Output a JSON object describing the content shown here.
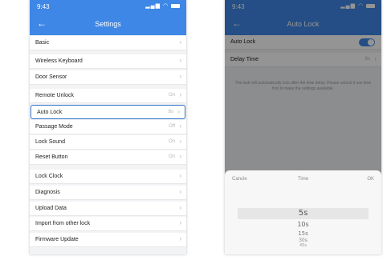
{
  "colors": {
    "accent": "#3e87e6",
    "highlight_border": "#3473c8"
  },
  "left_screen": {
    "status_time": "9:43",
    "title": "Settings",
    "rows": [
      {
        "label": "Basic",
        "value": ""
      },
      {
        "label": "Wireless Keyboard",
        "value": ""
      },
      {
        "label": "Door Sensor",
        "value": ""
      },
      {
        "label": "Remote Unlock",
        "value": "On"
      },
      {
        "label": "Auto Lock",
        "value": "8s"
      },
      {
        "label": "Passage Mode",
        "value": "Off"
      },
      {
        "label": "Lock Sound",
        "value": "On"
      },
      {
        "label": "Reset Button",
        "value": "On"
      },
      {
        "label": "Lock Clock",
        "value": ""
      },
      {
        "label": "Diagnosis",
        "value": ""
      },
      {
        "label": "Upload Data",
        "value": ""
      },
      {
        "label": "Import from other lock",
        "value": ""
      },
      {
        "label": "Firmware Update",
        "value": ""
      }
    ]
  },
  "right_screen": {
    "status_time": "9:43",
    "title": "Auto Lock",
    "auto_lock_label": "Auto Lock",
    "auto_lock_on": true,
    "delay_label": "Delay Time",
    "delay_value": "8s",
    "hint": "The lock will automatically lock after the time delay. Please unlock it use time first to make the settings available.",
    "picker": {
      "cancel": "Cancle",
      "title": "Time",
      "ok": "OK",
      "options": [
        "5s",
        "10s",
        "15s",
        "30s",
        "45s"
      ]
    }
  }
}
